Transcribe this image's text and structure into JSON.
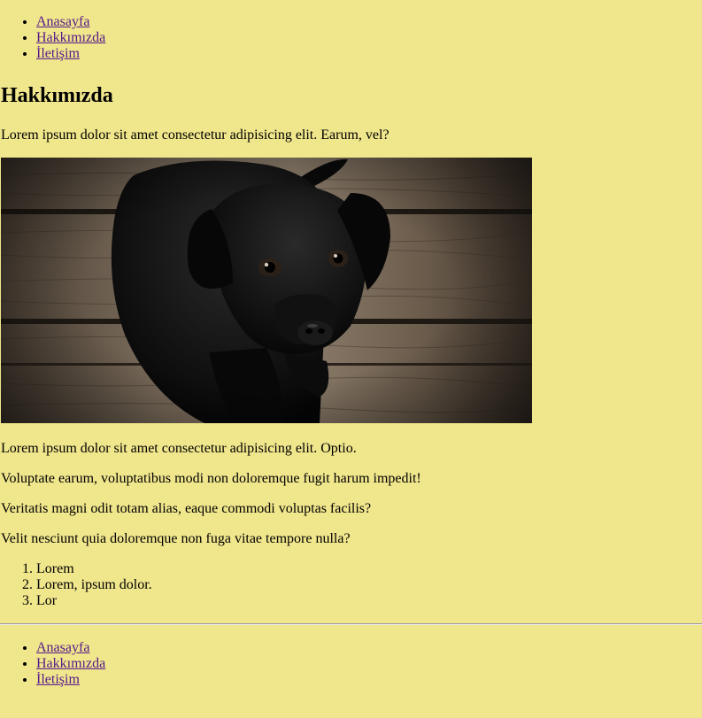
{
  "header_nav": {
    "items": [
      {
        "label": "Anasayfa"
      },
      {
        "label": "Hakkımızda"
      },
      {
        "label": "İletişim"
      }
    ]
  },
  "main": {
    "title": "Hakkımızda",
    "intro": "Lorem ipsum dolor sit amet consectetur adipisicing elit. Earum, vel?",
    "image": {
      "subject": "black-puppy-on-wooden-floor"
    },
    "paragraphs": [
      "Lorem ipsum dolor sit amet consectetur adipisicing elit. Optio.",
      "Voluptate earum, voluptatibus modi non doloremque fugit harum impedit!",
      "Veritatis magni odit totam alias, eaque commodi voluptas facilis?",
      "Velit nesciunt quia doloremque non fuga vitae tempore nulla?"
    ],
    "ordered_list": [
      "Lorem",
      "Lorem, ipsum dolor.",
      "Lor"
    ]
  },
  "footer_nav": {
    "items": [
      {
        "label": "Anasayfa"
      },
      {
        "label": "Hakkımızda"
      },
      {
        "label": "İletişim"
      }
    ]
  },
  "colors": {
    "background": "#f0e68c",
    "link": "#551a8b",
    "text": "#000000"
  }
}
